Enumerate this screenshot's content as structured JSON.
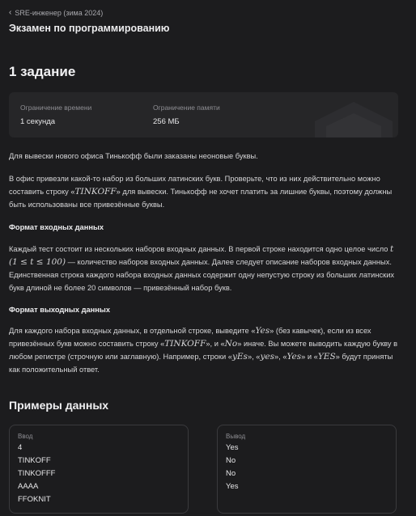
{
  "breadcrumb": {
    "label": "SRE-инженер (зима 2024)"
  },
  "exam_title": "Экзамен по программированию",
  "task_title": "1 задание",
  "limits": {
    "time_label": "Ограничение времени",
    "time_value": "1 секунда",
    "memory_label": "Ограничение памяти",
    "memory_value": "256 МБ"
  },
  "statement": {
    "p1": "Для вывески нового офиса Тинькофф были заказаны неоновые буквы.",
    "p2_a": "В офис привезли какой-то набор из больших латинских букв. Проверьте, что из них действительно можно составить строку «",
    "p2_math": "TINKOFF",
    "p2_b": "» для вывески. Тинькофф не хочет платить за лишние буквы, поэтому должны быть использованы все привезённые буквы.",
    "input_heading": "Формат входных данных",
    "p3_a": "Каждый тест состоит из нескольких наборов входных данных. В первой строке находится одно целое число ",
    "p3_math": "t (1 ≤ t ≤ 100)",
    "p3_b": " — количество наборов входных данных. Далее следует описание наборов входных данных. Единственная строка каждого набора входных данных содержит одну непустую строку из больших латинских букв длиной не более 20 символов — привезённый набор букв.",
    "output_heading": "Формат выходных данных",
    "p4_a": "Для каждого набора входных данных, в отдельной строке, выведите «",
    "p4_m1": "Yes",
    "p4_b": "» (без кавычек), если из всех привезённых букв можно составить строку «",
    "p4_m2": "TINKOFF",
    "p4_c": "», и «",
    "p4_m3": "No",
    "p4_d": "» иначе. Вы можете выводить каждую букву в любом регистре (строчную или заглавную). Например, строки «",
    "p4_m4": "yEs",
    "p4_e": "», «",
    "p4_m5": "yes",
    "p4_f": "», «",
    "p4_m6": "Yes",
    "p4_g": "» и «",
    "p4_m7": "YES",
    "p4_h": "» будут приняты как положительный ответ."
  },
  "examples": {
    "title": "Примеры данных",
    "input_label": "Ввод",
    "input_lines": [
      "4",
      "TINKOFF",
      "TINKOFFF",
      "AAAA",
      "FFOKNIT"
    ],
    "output_label": "Вывод",
    "output_lines": [
      "Yes",
      "No",
      "No",
      "Yes"
    ]
  }
}
